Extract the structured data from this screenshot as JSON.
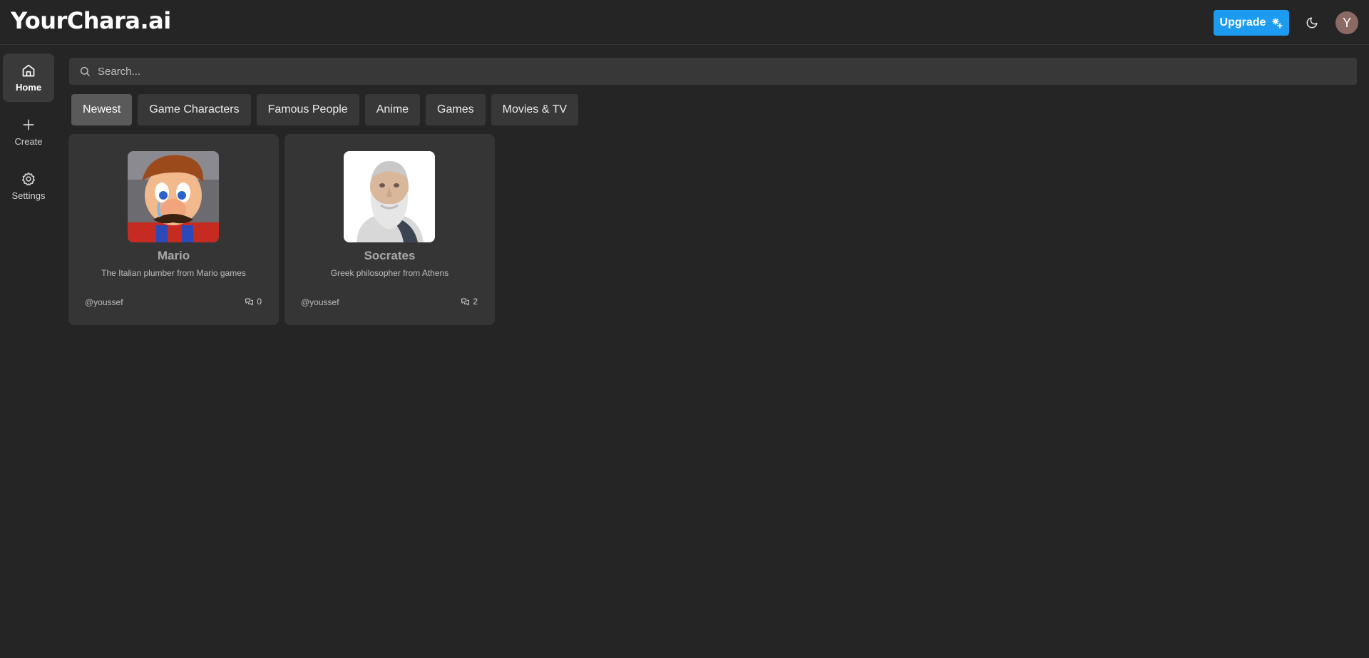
{
  "app": {
    "logo": "YourChara.ai"
  },
  "header": {
    "upgrade_label": "Upgrade",
    "avatar_initial": "Y",
    "accent_color": "#1d9bf0"
  },
  "sidebar": {
    "items": [
      {
        "label": "Home",
        "icon": "home-icon",
        "active": true
      },
      {
        "label": "Create",
        "icon": "plus-icon",
        "active": false
      },
      {
        "label": "Settings",
        "icon": "gear-icon",
        "active": false
      }
    ]
  },
  "search": {
    "placeholder": "Search...",
    "value": ""
  },
  "tabs": [
    {
      "label": "Newest",
      "active": true
    },
    {
      "label": "Game Characters",
      "active": false
    },
    {
      "label": "Famous People",
      "active": false
    },
    {
      "label": "Anime",
      "active": false
    },
    {
      "label": "Games",
      "active": false
    },
    {
      "label": "Movies & TV",
      "active": false
    }
  ],
  "characters": [
    {
      "name": "Mario",
      "description": "The Italian plumber from Mario games",
      "author": "@youssef",
      "chat_count": "0",
      "image": "mario-portrait"
    },
    {
      "name": "Socrates",
      "description": "Greek philosopher from Athens",
      "author": "@youssef",
      "chat_count": "2",
      "image": "socrates-bust"
    }
  ]
}
